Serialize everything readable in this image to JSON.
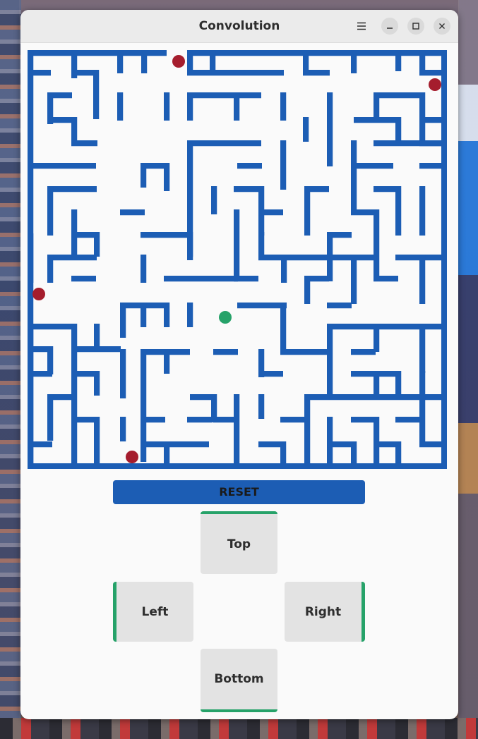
{
  "window": {
    "title": "Convolution",
    "menu_icon": "hamburger-menu-icon",
    "minimize_icon": "minimize-icon",
    "maximize_icon": "maximize-icon",
    "close_icon": "close-icon"
  },
  "game": {
    "wall_color": "#1c5db4",
    "floor_color": "#fafafa",
    "player_color": "#26a269",
    "enemy_color": "#a51d2d",
    "grid": [
      "################################################################################################################################################################################",
      "#.........#....#...#...#......#...#........#....#...#......#...#....#",
      "#"
    ]
  },
  "controls": {
    "reset_label": "RESET",
    "top_label": "Top",
    "left_label": "Left",
    "right_label": "Right",
    "bottom_label": "Bottom"
  }
}
